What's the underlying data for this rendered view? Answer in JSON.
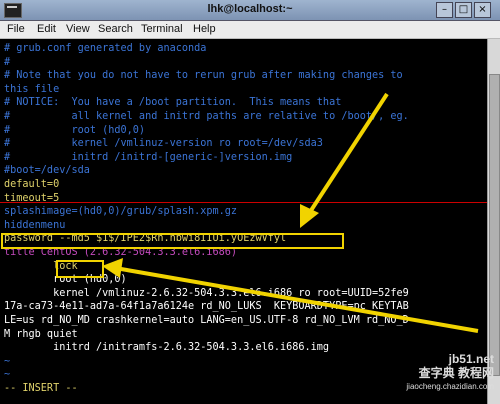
{
  "window": {
    "title": "lhk@localhost:~"
  },
  "menu": [
    "File",
    "Edit",
    "View",
    "Search",
    "Terminal",
    "Help"
  ],
  "terminal": {
    "lines": [
      {
        "cls": "c",
        "text": "# grub.conf generated by anaconda"
      },
      {
        "cls": "c",
        "text": "#"
      },
      {
        "cls": "c",
        "text": "# Note that you do not have to rerun grub after making changes to"
      },
      {
        "cls": "c",
        "text": "this file"
      },
      {
        "cls": "c",
        "text": "# NOTICE:  You have a /boot partition.  This means that"
      },
      {
        "cls": "c",
        "text": "#          all kernel and initrd paths are relative to /boot/, eg."
      },
      {
        "cls": "c",
        "text": "#          root (hd0,0)"
      },
      {
        "cls": "c",
        "text": "#          kernel /vmlinuz-version ro root=/dev/sda3"
      },
      {
        "cls": "c",
        "text": "#          initrd /initrd-[generic-]version.img"
      },
      {
        "cls": "c",
        "text": "#boot=/dev/sda"
      },
      {
        "cls": "y",
        "text": "default=0"
      },
      {
        "cls": "y",
        "text": "timeout=5"
      },
      {
        "cls": "c",
        "text": "splashimage=(hd0,0)/grub/splash.xpm.gz"
      },
      {
        "cls": "c",
        "text": "hiddenmenu"
      },
      {
        "cls": "y",
        "text": "password --md5 $1$/IPE2$Rh.hbwi8IIUi.yOEzwVfyl"
      },
      {
        "cls": "p",
        "text": "title CentOS (2.6.32-504.3.3.el6.i686)"
      },
      {
        "cls": "y",
        "text": "        lock"
      },
      {
        "cls": "g",
        "text": "        root (hd0,0)"
      },
      {
        "cls": "g",
        "text": "        kernel /vmlinuz-2.6.32-504.3.3.el6.i686 ro root=UUID=52fe9"
      },
      {
        "cls": "g",
        "text": "17a-ca73-4e11-ad7a-64f1a7a6124e rd_NO_LUKS  KEYBOARDTYPE=pc KEYTAB"
      },
      {
        "cls": "g",
        "text": "LE=us rd_NO_MD crashkernel=auto LANG=en_US.UTF-8 rd_NO_LVM rd_NO_D"
      },
      {
        "cls": "g",
        "text": "M rhgb quiet"
      },
      {
        "cls": "g",
        "text": "        initrd /initramfs-2.6.32-504.3.3.el6.i686.img"
      },
      {
        "cls": "c",
        "text": "~"
      },
      {
        "cls": "c",
        "text": "~"
      },
      {
        "cls": "y",
        "text": "-- INSERT --"
      }
    ]
  },
  "watermark": {
    "line1": "jb51.net",
    "line2": "查字典 教程网",
    "line3": "jiaocheng.chazidian.com"
  },
  "colors": {
    "comment": "#3b74d6",
    "keyword": "#e0d36b",
    "title": "#c54bbf",
    "highlight": "#f1d300"
  }
}
